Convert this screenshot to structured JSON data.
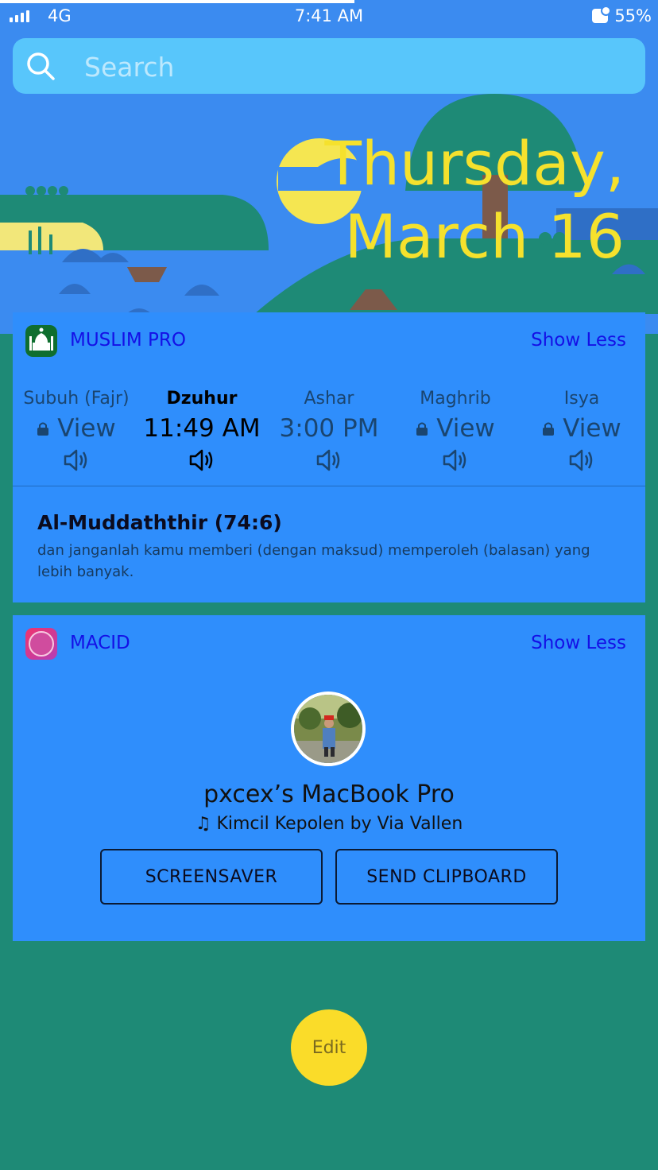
{
  "status_bar": {
    "carrier": "4G",
    "time": "7:41 AM",
    "battery": "55%"
  },
  "search": {
    "placeholder": "Search"
  },
  "date": {
    "line1": "Thursday,",
    "line2": "March 16"
  },
  "muslim_pro": {
    "app_name": "MUSLIM PRO",
    "show_less": "Show Less",
    "prayers": [
      {
        "name": "Subuh (Fajr)",
        "time": "View",
        "locked": true
      },
      {
        "name": "Dzuhur",
        "time": "11:49 AM",
        "locked": false,
        "active": true
      },
      {
        "name": "Ashar",
        "time": "3:00 PM",
        "locked": false
      },
      {
        "name": "Maghrib",
        "time": "View",
        "locked": true
      },
      {
        "name": "Isya",
        "time": "View",
        "locked": true
      }
    ],
    "verse_title": "Al-Muddaththir (74:6)",
    "verse_text": "dan janganlah kamu memberi (dengan maksud) memperoleh (balasan) yang lebih banyak."
  },
  "macid": {
    "app_name": "MACID",
    "show_less": "Show Less",
    "device_name": "pxcex’s MacBook Pro",
    "now_playing": "Kimcil Kepolen by Via Vallen",
    "screensaver_label": "SCREENSAVER",
    "clipboard_label": "SEND CLIPBOARD"
  },
  "edit_label": "Edit"
}
